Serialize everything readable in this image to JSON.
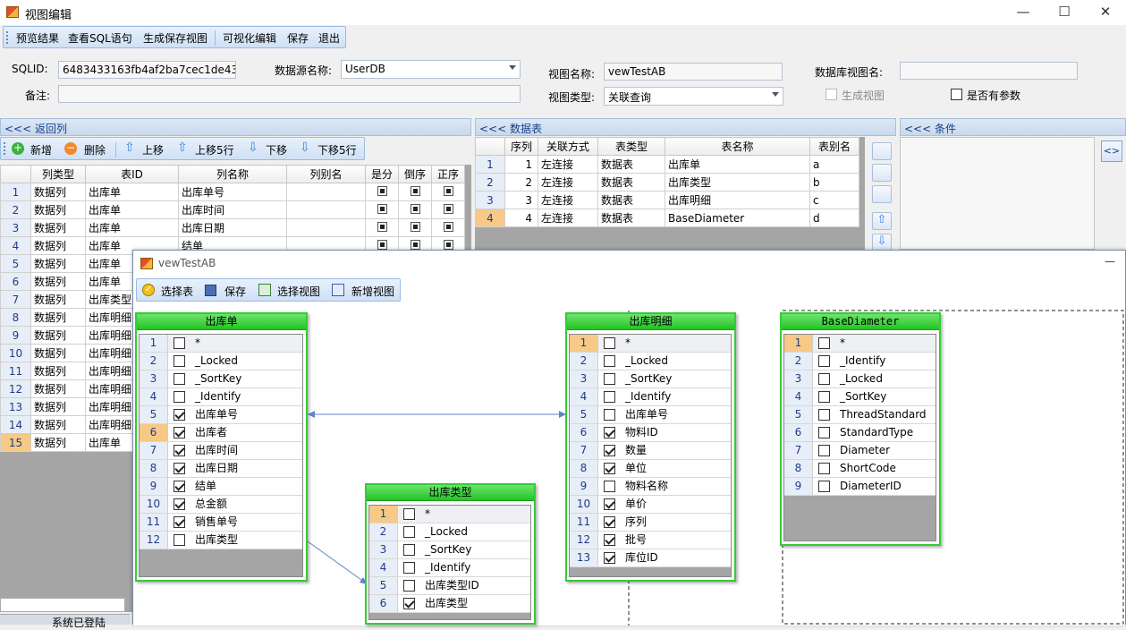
{
  "window": {
    "title": "视图编辑",
    "min": "—",
    "max": "☐",
    "close": "✕"
  },
  "toolbar": {
    "preview": "预览结果",
    "view_sql": "查看SQL语句",
    "gen_save": "生成保存视图",
    "visual_edit": "可视化编辑",
    "save": "保存",
    "exit": "退出"
  },
  "form": {
    "sqlid_label": "SQLID:",
    "sqlid_value": "6483433163fb4af2ba7cec1de4334",
    "datasource_label": "数据源名称:",
    "datasource_value": "UserDB",
    "view_name_label": "视图名称:",
    "view_name_value": "vewTestAB",
    "db_view_label": "数据库视图名:",
    "db_view_value": "",
    "remark_label": "备注:",
    "remark_value": "",
    "view_type_label": "视图类型:",
    "view_type_value": "关联查询",
    "gen_view_label": "生成视图",
    "has_param_label": "是否有参数"
  },
  "return_cols": {
    "header": "<<< 返回列",
    "buttons": {
      "add": "新增",
      "delete": "删除",
      "up": "上移",
      "up5": "上移5行",
      "down": "下移",
      "down5": "下移5行"
    },
    "columns": [
      "列类型",
      "表ID",
      "列名称",
      "列别名",
      "是分",
      "倒序",
      "正序"
    ],
    "rows": [
      [
        "1",
        "数据列",
        "出库单",
        "出库单号"
      ],
      [
        "2",
        "数据列",
        "出库单",
        "出库时间"
      ],
      [
        "3",
        "数据列",
        "出库单",
        "出库日期"
      ],
      [
        "4",
        "数据列",
        "出库单",
        "结单"
      ],
      [
        "5",
        "数据列",
        "出库单",
        ""
      ],
      [
        "6",
        "数据列",
        "出库单",
        ""
      ],
      [
        "7",
        "数据列",
        "出库类型",
        ""
      ],
      [
        "8",
        "数据列",
        "出库明细",
        ""
      ],
      [
        "9",
        "数据列",
        "出库明细",
        ""
      ],
      [
        "10",
        "数据列",
        "出库明细",
        ""
      ],
      [
        "11",
        "数据列",
        "出库明细",
        ""
      ],
      [
        "12",
        "数据列",
        "出库明细",
        ""
      ],
      [
        "13",
        "数据列",
        "出库明细",
        ""
      ],
      [
        "14",
        "数据列",
        "出库明细",
        ""
      ],
      [
        "15",
        "数据列",
        "出库单",
        ""
      ]
    ],
    "bottom_tab": "系统已登陆"
  },
  "data_tables": {
    "header": "<<< 数据表",
    "columns": [
      "序列",
      "关联方式",
      "表类型",
      "表名称",
      "表别名"
    ],
    "rows": [
      [
        "1",
        "1",
        "左连接",
        "数据表",
        "出库单",
        "a"
      ],
      [
        "2",
        "2",
        "左连接",
        "数据表",
        "出库类型",
        "b"
      ],
      [
        "3",
        "3",
        "左连接",
        "数据表",
        "出库明细",
        "c"
      ],
      [
        "4",
        "4",
        "左连接",
        "数据表",
        "BaseDiameter",
        "d"
      ]
    ]
  },
  "conditions": {
    "header": "<<< 条件",
    "code_btn": "<>"
  },
  "designer": {
    "title": "vewTestAB",
    "min": "—",
    "toolbar": {
      "select_table": "选择表",
      "save": "保存",
      "select_view": "选择视图",
      "new_view": "新增视图"
    },
    "tables": [
      {
        "name": "出库单",
        "fields": [
          {
            "n": "1",
            "t": "*",
            "on": false
          },
          {
            "n": "2",
            "t": "_Locked",
            "on": false
          },
          {
            "n": "3",
            "t": "_SortKey",
            "on": false
          },
          {
            "n": "4",
            "t": "_Identify",
            "on": false
          },
          {
            "n": "5",
            "t": "出库单号",
            "on": true
          },
          {
            "n": "6",
            "t": "出库者",
            "on": true
          },
          {
            "n": "7",
            "t": "出库时间",
            "on": true
          },
          {
            "n": "8",
            "t": "出库日期",
            "on": true
          },
          {
            "n": "9",
            "t": "结单",
            "on": true
          },
          {
            "n": "10",
            "t": "总金额",
            "on": true
          },
          {
            "n": "11",
            "t": "销售单号",
            "on": true
          },
          {
            "n": "12",
            "t": "出库类型",
            "on": false
          }
        ]
      },
      {
        "name": "出库类型",
        "fields": [
          {
            "n": "1",
            "t": "*",
            "on": false
          },
          {
            "n": "2",
            "t": "_Locked",
            "on": false
          },
          {
            "n": "3",
            "t": "_SortKey",
            "on": false
          },
          {
            "n": "4",
            "t": "_Identify",
            "on": false
          },
          {
            "n": "5",
            "t": "出库类型ID",
            "on": false
          },
          {
            "n": "6",
            "t": "出库类型",
            "on": true
          }
        ]
      },
      {
        "name": "出库明细",
        "fields": [
          {
            "n": "1",
            "t": "*",
            "on": false
          },
          {
            "n": "2",
            "t": "_Locked",
            "on": false
          },
          {
            "n": "3",
            "t": "_SortKey",
            "on": false
          },
          {
            "n": "4",
            "t": "_Identify",
            "on": false
          },
          {
            "n": "5",
            "t": "出库单号",
            "on": false
          },
          {
            "n": "6",
            "t": "物料ID",
            "on": true
          },
          {
            "n": "7",
            "t": "数量",
            "on": true
          },
          {
            "n": "8",
            "t": "单位",
            "on": true
          },
          {
            "n": "9",
            "t": "物料名称",
            "on": false
          },
          {
            "n": "10",
            "t": "单价",
            "on": true
          },
          {
            "n": "11",
            "t": "序列",
            "on": true
          },
          {
            "n": "12",
            "t": "批号",
            "on": true
          },
          {
            "n": "13",
            "t": "库位ID",
            "on": true
          }
        ]
      },
      {
        "name": "BaseDiameter",
        "fields": [
          {
            "n": "1",
            "t": "*",
            "on": false
          },
          {
            "n": "2",
            "t": "_Identify",
            "on": false
          },
          {
            "n": "3",
            "t": "_Locked",
            "on": false
          },
          {
            "n": "4",
            "t": "_SortKey",
            "on": false
          },
          {
            "n": "5",
            "t": "ThreadStandard",
            "on": false
          },
          {
            "n": "6",
            "t": "StandardType",
            "on": false
          },
          {
            "n": "7",
            "t": "Diameter",
            "on": false
          },
          {
            "n": "8",
            "t": "ShortCode",
            "on": false
          },
          {
            "n": "9",
            "t": "DiameterID",
            "on": false
          }
        ]
      }
    ]
  }
}
